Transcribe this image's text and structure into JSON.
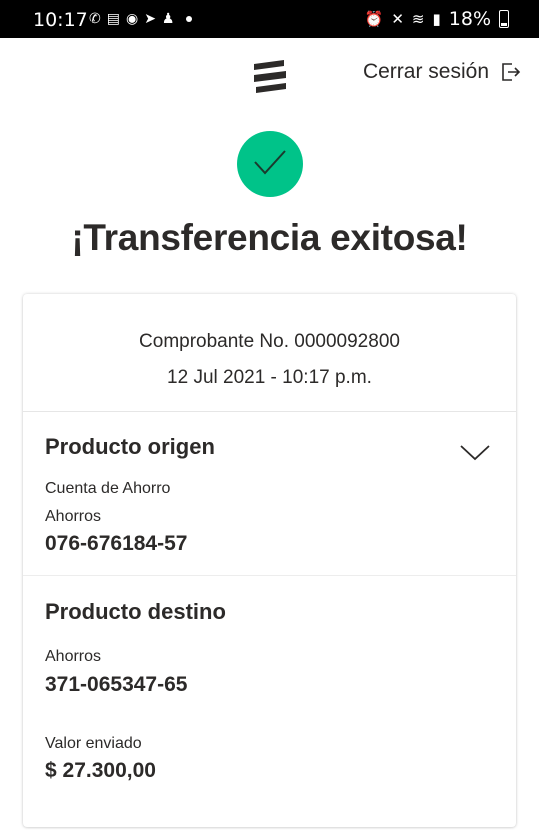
{
  "status_bar": {
    "time": "10:17",
    "battery": "18%",
    "left_icons": [
      "whatsapp-icon",
      "news-icon",
      "messenger-icon",
      "telegram-icon",
      "snapchat-icon"
    ],
    "right_icons": [
      "alarm-icon",
      "mute-icon",
      "wifi-icon",
      "signal-icon"
    ]
  },
  "header": {
    "logo": "bank-logo-icon",
    "logout_label": "Cerrar sesión"
  },
  "success": {
    "title": "¡Transferencia exitosa!",
    "icon": "check-icon",
    "color": "#00c389"
  },
  "receipt": {
    "number": "Comprobante No. 0000092800",
    "datetime": "12 Jul 2021 - 10:17 p.m."
  },
  "origin": {
    "title": "Producto origen",
    "account_type": "Cuenta de Ahorro",
    "product_label": "Ahorros",
    "account_number": "076-676184-57"
  },
  "destination": {
    "title": "Producto destino",
    "product_label": "Ahorros",
    "account_number": "371-065347-65",
    "amount_label": "Valor enviado",
    "amount": "$ 27.300,00"
  }
}
